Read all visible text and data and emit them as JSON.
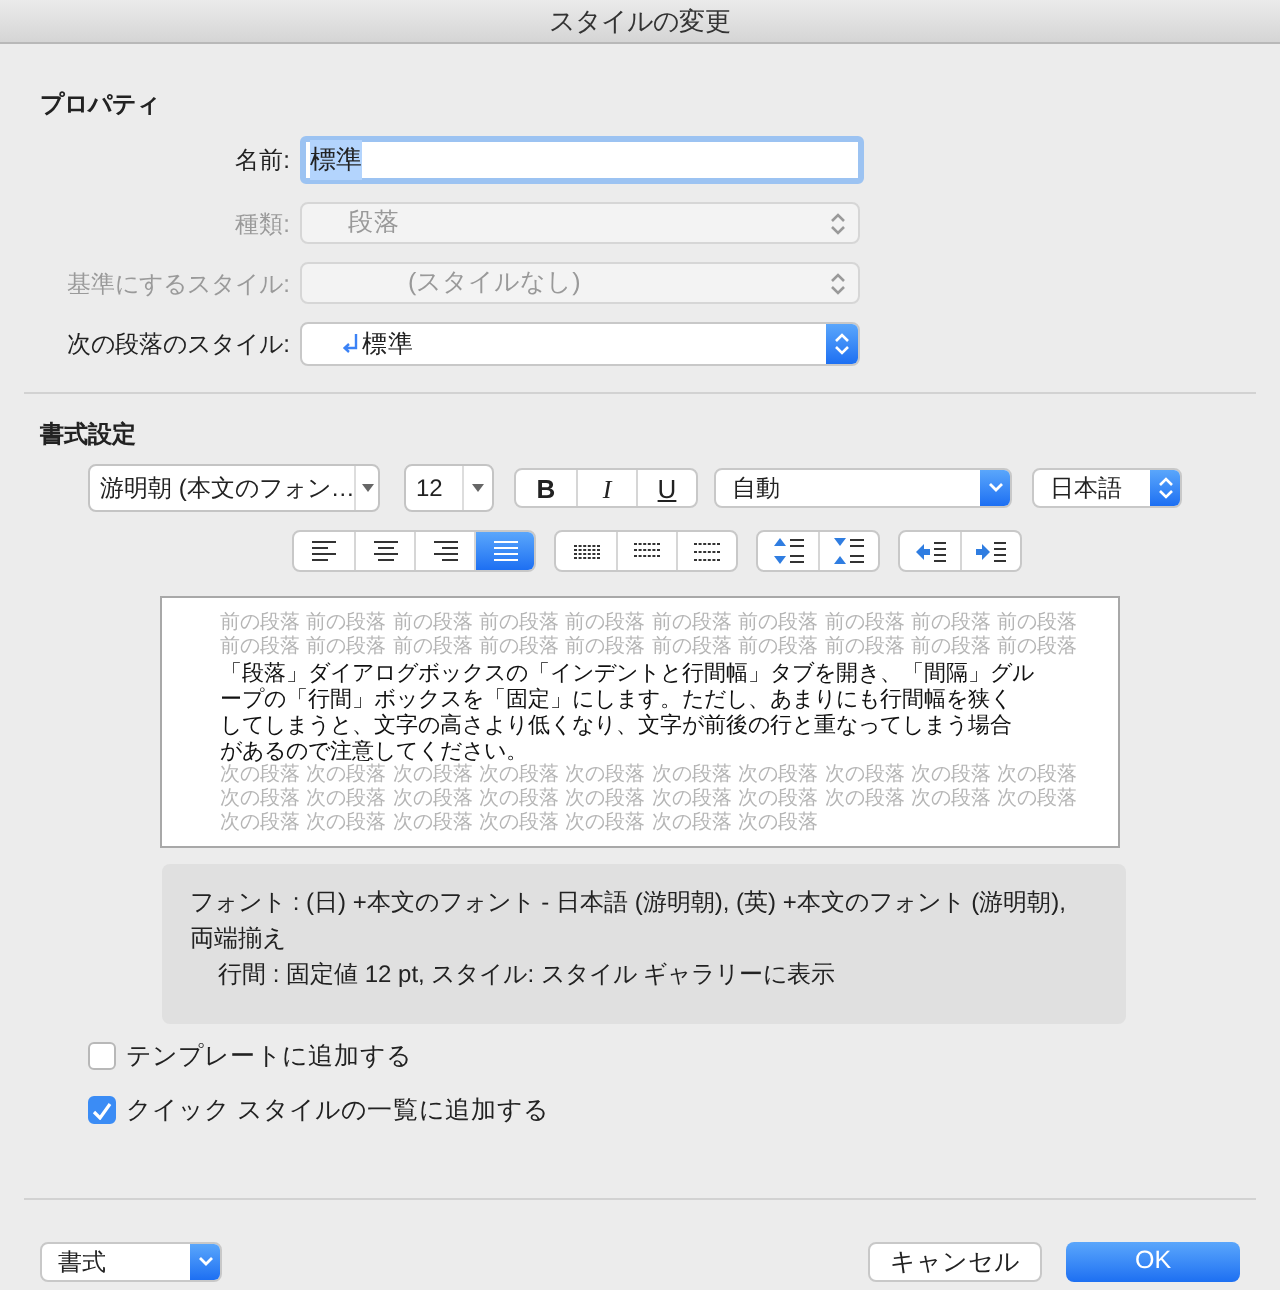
{
  "window": {
    "title": "スタイルの変更"
  },
  "properties": {
    "heading": "プロパティ",
    "fields": [
      {
        "label": "名前:",
        "value": "標準",
        "kind": "text",
        "disabled": false
      },
      {
        "label": "種類:",
        "value": "段落",
        "kind": "select",
        "disabled": true
      },
      {
        "label": "基準にするスタイル:",
        "value": "(スタイルなし)",
        "kind": "select",
        "disabled": true
      },
      {
        "label": "次の段落のスタイル:",
        "value": "標準",
        "kind": "popup",
        "disabled": false
      }
    ]
  },
  "format": {
    "heading": "書式設定",
    "font": "游明朝 (本文のフォン…",
    "size": "12",
    "text_styles": [
      "B",
      "I",
      "U"
    ],
    "text_color": "自動",
    "language": "日本語",
    "alignment": [
      {
        "kind": "left",
        "selected": false
      },
      {
        "kind": "center",
        "selected": false
      },
      {
        "kind": "right",
        "selected": false
      },
      {
        "kind": "justify",
        "selected": true
      }
    ],
    "line_spacing": [
      {
        "kind": "single"
      },
      {
        "kind": "one_half"
      },
      {
        "kind": "double"
      }
    ],
    "paragraph_spacing": [
      {
        "kind": "decrease"
      },
      {
        "kind": "increase"
      }
    ],
    "indent": [
      {
        "kind": "decrease"
      },
      {
        "kind": "increase"
      }
    ]
  },
  "preview": {
    "previous": [
      "前の段落 前の段落 前の段落 前の段落 前の段落 前の段落 前の段落 前の段落 前の段落 前の段落",
      "前の段落 前の段落 前の段落 前の段落 前の段落 前の段落 前の段落 前の段落 前の段落 前の段落"
    ],
    "body": [
      "「段落」ダイアログボックスの「インデントと行間幅」タブを開き、「間隔」グル",
      "ープの「行間」ボックスを「固定」にします。ただし、あまりにも行間幅を狭く",
      "してしまうと、文字の高さより低くなり、文字が前後の行と重なってしまう場合",
      "があるので注意してください。"
    ],
    "next": [
      "次の段落 次の段落 次の段落 次の段落 次の段落 次の段落 次の段落 次の段落 次の段落 次の段落",
      "次の段落 次の段落 次の段落 次の段落 次の段落 次の段落 次の段落 次の段落 次の段落 次の段落",
      "次の段落 次の段落 次の段落 次の段落 次の段落 次の段落 次の段落"
    ]
  },
  "description": [
    "フォント : (日) +本文のフォント - 日本語 (游明朝), (英) +本文のフォント (游明朝),",
    "両端揃え",
    "行間 :  固定値 12 pt, スタイル: スタイル ギャラリーに表示"
  ],
  "checkboxes": [
    {
      "label": "テンプレートに追加する",
      "checked": false
    },
    {
      "label": "クイック スタイルの一覧に追加する",
      "checked": true
    }
  ],
  "footer": {
    "menu": "書式",
    "buttons": [
      {
        "label": "キャンセル",
        "kind": "secondary"
      },
      {
        "label": "OK",
        "kind": "primary"
      }
    ]
  }
}
